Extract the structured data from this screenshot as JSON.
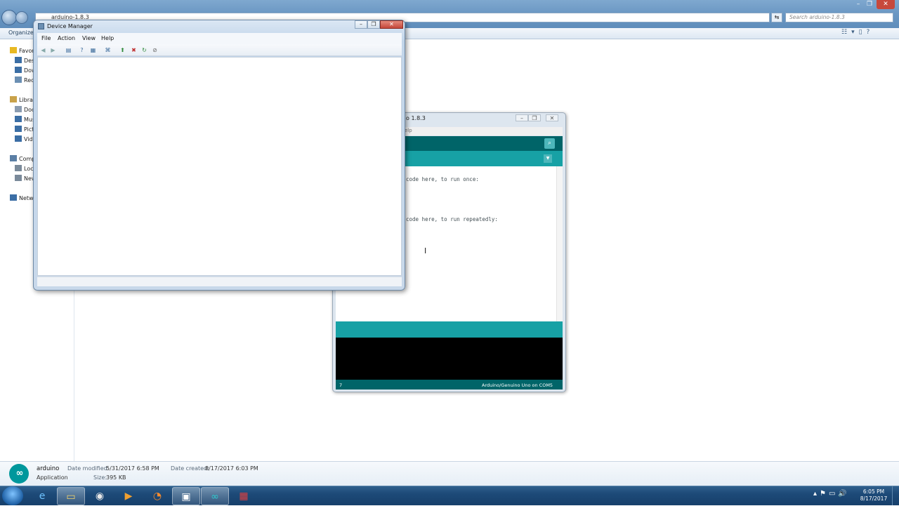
{
  "explorer": {
    "path": "arduino-1.8.3",
    "search_placeholder": "Search arduino-1.8.3",
    "organize": "Organize",
    "sidebar": [
      {
        "label": "Favorites",
        "icon": "star-icon",
        "color": "#e8b923"
      },
      {
        "label": "Desktop",
        "icon": "desktop-icon",
        "color": "#3b6ea5"
      },
      {
        "label": "Downloads",
        "icon": "downloads-icon",
        "color": "#3b6ea5"
      },
      {
        "label": "Recent Places",
        "icon": "recent-icon",
        "color": "#6b8fb3"
      },
      {
        "label": "Libraries",
        "icon": "library-icon",
        "color": "#c9a24a"
      },
      {
        "label": "Documents",
        "icon": "documents-icon",
        "color": "#8a9bb0"
      },
      {
        "label": "Music",
        "icon": "music-icon",
        "color": "#3b6ea5"
      },
      {
        "label": "Pictures",
        "icon": "pictures-icon",
        "color": "#3b6ea5"
      },
      {
        "label": "Videos",
        "icon": "videos-icon",
        "color": "#3b6ea5"
      },
      {
        "label": "Computer",
        "icon": "computer-icon",
        "color": "#5b7fa5"
      },
      {
        "label": "Local Disk (C:)",
        "icon": "disk-icon",
        "color": "#7a8a9a"
      },
      {
        "label": "New Volume (D:)",
        "icon": "disk-icon",
        "color": "#7a8a9a"
      },
      {
        "label": "Network",
        "icon": "network-icon",
        "color": "#3b6ea5"
      }
    ],
    "details": {
      "name": "arduino",
      "type": "Application",
      "modified_label": "Date modified:",
      "modified_value": "5/31/2017 6:58 PM",
      "created_label": "Date created:",
      "created_value": "8/17/2017 6:03 PM",
      "size_label": "Size:",
      "size_value": "395 KB"
    }
  },
  "device_manager": {
    "title": "Device Manager",
    "menus": [
      "File",
      "Action",
      "View",
      "Help"
    ]
  },
  "arduino_ide": {
    "title_fragment": "o 1.8.3",
    "menu_fragment": "elp",
    "code_lines": [
      "code here, to run once:",
      "code here, to run repeatedly:"
    ],
    "line_number": "7",
    "board": "Arduino/Genuino Uno on COM5"
  },
  "taskbar": {
    "items": [
      {
        "icon": "ie-icon",
        "active": false
      },
      {
        "icon": "folder-icon",
        "active": true
      },
      {
        "icon": "chrome-icon",
        "active": false
      },
      {
        "icon": "media-player-icon",
        "active": false
      },
      {
        "icon": "firefox-icon",
        "active": false
      },
      {
        "icon": "device-manager-icon",
        "active": true
      },
      {
        "icon": "arduino-icon",
        "active": true
      },
      {
        "icon": "app-icon",
        "active": false
      }
    ],
    "time": "6:05 PM",
    "date": "8/17/2017"
  },
  "colors": {
    "arduino_teal_dark": "#006468",
    "arduino_teal": "#17a1a5",
    "win7_taskbar": "#1d4a78"
  }
}
